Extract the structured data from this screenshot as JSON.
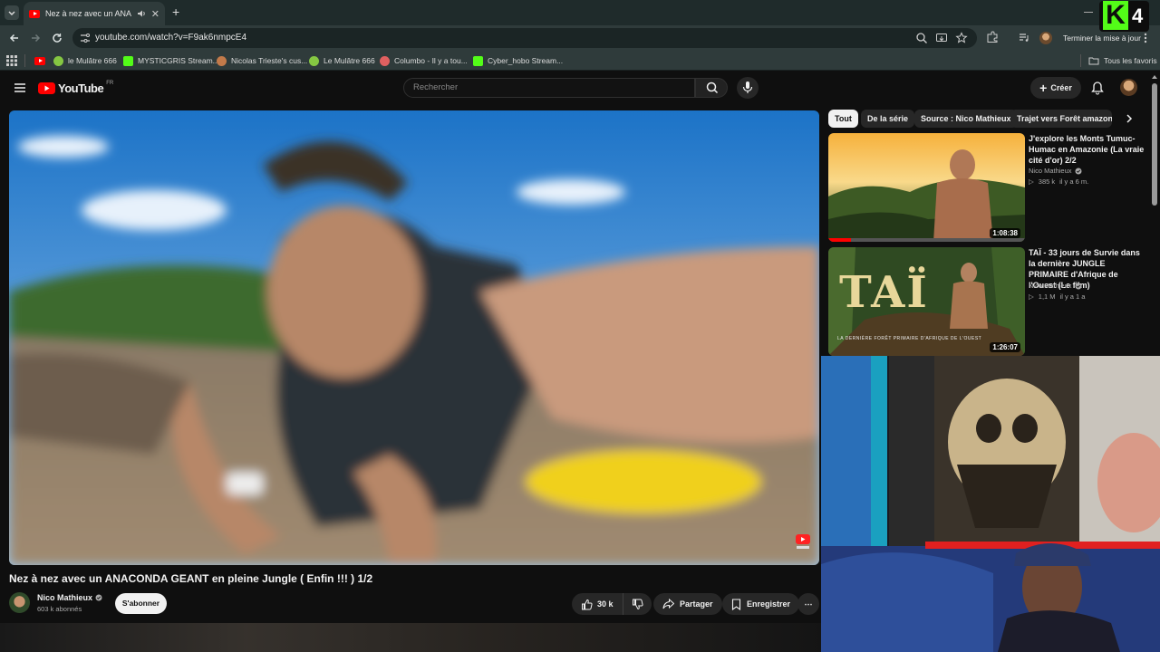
{
  "browser": {
    "tab_title": "Nez à nez avec un ANACONDA",
    "tab_close": "✕",
    "new_tab": "+",
    "url": "youtube.com/watch?v=F9ak6nmpcE4",
    "update_button": "Terminer la mise à jour",
    "bookmarks": [
      {
        "label": "",
        "icon": "youtube-icon",
        "color": "#ff0000"
      },
      {
        "label": "le Mulâtre 666",
        "icon": "rumble-icon",
        "color": "#85c742"
      },
      {
        "label": "MYSTICGRIS Stream...",
        "icon": "kick-icon",
        "color": "#53fc18"
      },
      {
        "label": "Nicolas Trieste's cus...",
        "icon": "animal-icon",
        "color": "#c27a4a"
      },
      {
        "label": "Le Mulâtre 666",
        "icon": "rumble-icon",
        "color": "#85c742"
      },
      {
        "label": "Columbo - Il y a tou...",
        "icon": "site-icon",
        "color": "#e06060"
      },
      {
        "label": "Cyber_hobo Stream...",
        "icon": "kick-icon",
        "color": "#53fc18"
      }
    ],
    "all_bookmarks": "Tous les favoris"
  },
  "youtube": {
    "logo_text": "YouTube",
    "logo_region": "FR",
    "search_placeholder": "Rechercher",
    "create_button": "Créer"
  },
  "video": {
    "title": "Nez à nez avec un ANACONDA GEANT en pleine Jungle ( Enfin !!! ) 1/2",
    "channel_name": "Nico Mathieux",
    "subscribers": "603 k abonnés",
    "subscribe_button": "S'abonner",
    "likes": "30 k",
    "share_button": "Partager",
    "save_button": "Enregistrer",
    "more_button": "⋯"
  },
  "chips": [
    "Tout",
    "De la série",
    "Source : Nico Mathieux",
    "Trajet vers Forêt amazonienne"
  ],
  "recommendations": [
    {
      "title": "J'explore les Monts Tumuc-Humac en Amazonie (La vraie cité d'or) 2/2",
      "channel": "Nico Mathieux",
      "views": "385 k",
      "age": "il y a 6 m.",
      "duration": "1:08:38"
    },
    {
      "title": "TAÏ - 33 jours de Survie dans la dernière JUNGLE PRIMAIRE d'Afrique de l'Ouest (Le film)",
      "channel": "Nico Mathieux",
      "views": "1,1 M",
      "age": "il y a 1 a",
      "duration": "1:26:07",
      "thumb_text": "TAÏ",
      "thumb_subtext": "LA DERNIÈRE FORÊT PRIMAIRE D'AFRIQUE DE L'OUEST"
    }
  ],
  "overlay": {
    "logo_k": "K",
    "logo_number": "4"
  },
  "colors": {
    "accent_red": "#ff0000",
    "kick_green": "#53fc18",
    "background": "#0f0f0f"
  }
}
